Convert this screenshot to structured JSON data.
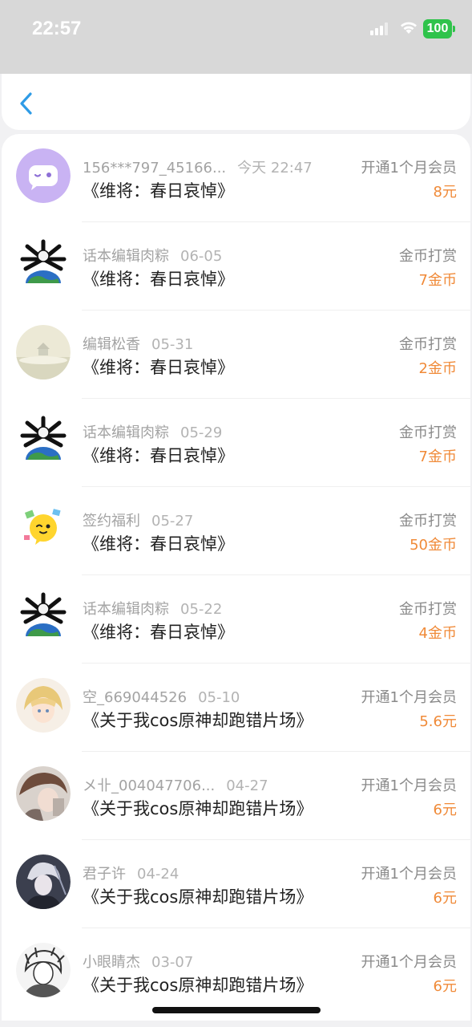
{
  "status_bar": {
    "time": "22:57",
    "battery": "100"
  },
  "colors": {
    "accent": "#2e9be6",
    "amount": "#f08a38",
    "battery": "#2fc34b"
  },
  "rows": [
    {
      "user": "156***797_45166...",
      "date": "今天 22:47",
      "title": "《维将：春日哀悼》",
      "type": "开通1个月会员",
      "amount": "8元",
      "avatar": "chat-bubble-avatar"
    },
    {
      "user": "话本编辑肉粽",
      "date": "06-05",
      "title": "《维将：春日哀悼》",
      "type": "金币打赏",
      "amount": "7金币",
      "avatar": "earth-bones-avatar"
    },
    {
      "user": "编辑松香",
      "date": "05-31",
      "title": "《维将：春日哀悼》",
      "type": "金币打赏",
      "amount": "2金币",
      "avatar": "misty-pavilion-avatar"
    },
    {
      "user": "话本编辑肉粽",
      "date": "05-29",
      "title": "《维将：春日哀悼》",
      "type": "金币打赏",
      "amount": "7金币",
      "avatar": "earth-bones-avatar"
    },
    {
      "user": "签约福利",
      "date": "05-27",
      "title": "《维将：春日哀悼》",
      "type": "金币打赏",
      "amount": "50金币",
      "avatar": "yellow-bubble-avatar"
    },
    {
      "user": "话本编辑肉粽",
      "date": "05-22",
      "title": "《维将：春日哀悼》",
      "type": "金币打赏",
      "amount": "4金币",
      "avatar": "earth-bones-avatar"
    },
    {
      "user": "空_669044526",
      "date": "05-10",
      "title": "《关于我cos原神却跑错片场》",
      "type": "开通1个月会员",
      "amount": "5.6元",
      "avatar": "blonde-character-avatar"
    },
    {
      "user": "メ卝_004047706...",
      "date": "04-27",
      "title": "《关于我cos原神却跑错片场》",
      "type": "开通1个月会员",
      "amount": "6元",
      "avatar": "brown-hair-avatar"
    },
    {
      "user": "君子许",
      "date": "04-24",
      "title": "《关于我cos原神却跑错片场》",
      "type": "开通1个月会员",
      "amount": "6元",
      "avatar": "dark-character-avatar"
    },
    {
      "user": "小眼睛杰",
      "date": "03-07",
      "title": "《关于我cos原神却跑错片场》",
      "type": "开通1个月会员",
      "amount": "6元",
      "avatar": "sketch-character-avatar"
    }
  ]
}
